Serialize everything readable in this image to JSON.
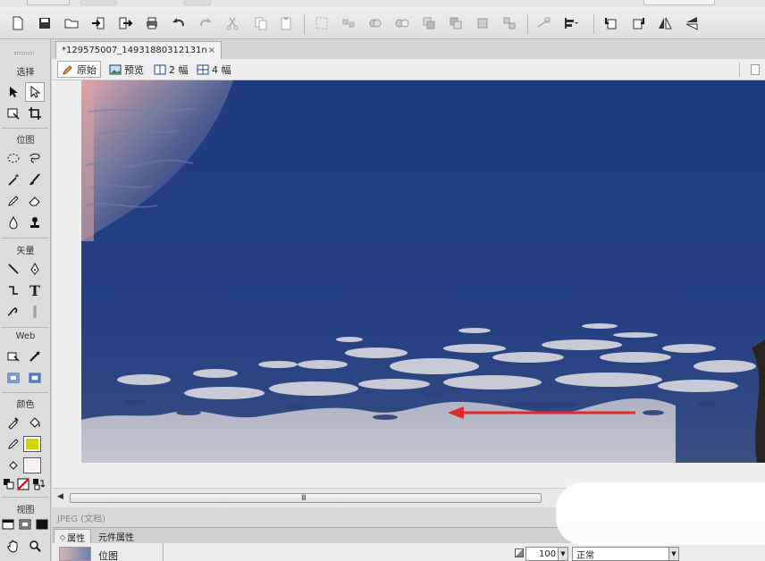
{
  "app": {
    "document_tab_title": "*129575007_14931880312131n",
    "document_tab_close": "×"
  },
  "view_modes": {
    "original": "原始",
    "preview": "预览",
    "two_up": "2 幅",
    "four_up": "4 幅"
  },
  "tools_panel": {
    "section_select": "选择",
    "section_bitmap": "位图",
    "section_vector": "矢量",
    "section_web": "Web",
    "section_colors": "颜色",
    "section_view": "视图",
    "text_tool_glyph": "T",
    "stroke_color": "#d4d400",
    "fill_color": "#f7eeee"
  },
  "status": {
    "document_info": "JPEG (文档)"
  },
  "properties_panel": {
    "tab_properties": "属性",
    "tab_symbol_properties": "元件属性",
    "object_kind": "位图",
    "opacity": "100",
    "blend_mode": "正常"
  },
  "scrollbar": {
    "grip": "III"
  },
  "colors": {
    "water_dark": "#1f3d80",
    "water_light": "#b8bccc",
    "arrow": "#e02a2a"
  }
}
